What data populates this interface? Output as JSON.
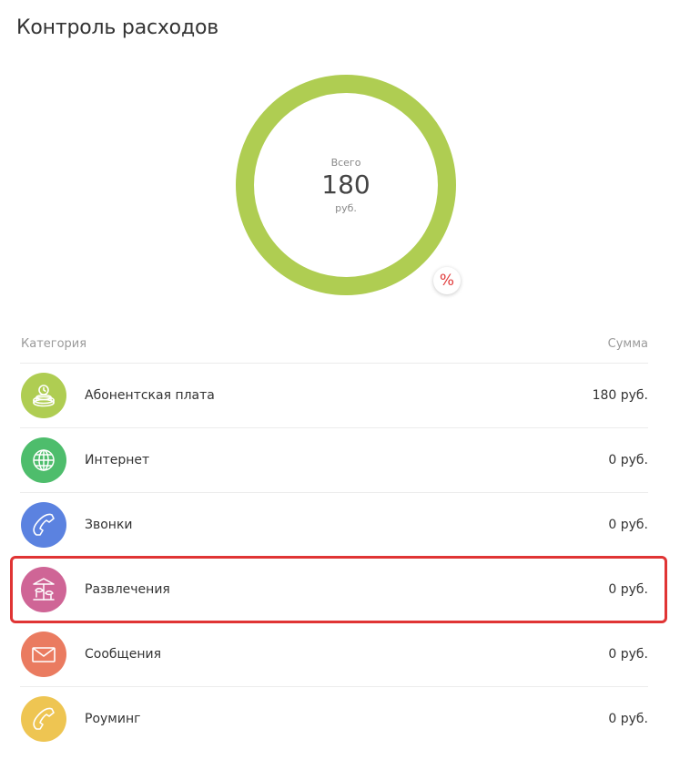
{
  "page": {
    "title": "Контроль расходов"
  },
  "summary": {
    "label": "Всего",
    "value": "180",
    "unit": "руб.",
    "ring_color": "#afcd52",
    "percent_toggle": "%"
  },
  "table": {
    "header_category": "Категория",
    "header_sum": "Сумма",
    "rows": [
      {
        "label": "Абонентская плата",
        "amount": "180 руб.",
        "icon": "coin-stack-icon",
        "color": "#afcd52"
      },
      {
        "label": "Интернет",
        "amount": "0 руб.",
        "icon": "globe-icon",
        "color": "#4ebd6c"
      },
      {
        "label": "Звонки",
        "amount": "0 руб.",
        "icon": "phone-icon",
        "color": "#5b82e0"
      },
      {
        "label": "Развлечения",
        "amount": "0 руб.",
        "icon": "carousel-icon",
        "color": "#cf6596"
      },
      {
        "label": "Сообщения",
        "amount": "0 руб.",
        "icon": "envelope-icon",
        "color": "#ea7b60"
      },
      {
        "label": "Роуминг",
        "amount": "0 руб.",
        "icon": "phone-icon",
        "color": "#eec552"
      }
    ]
  },
  "highlight": {
    "color": "#e03434"
  }
}
